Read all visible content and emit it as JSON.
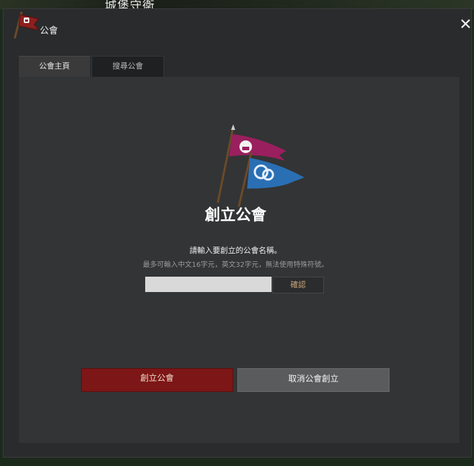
{
  "background": {
    "title": "城堡守衛"
  },
  "window": {
    "title": "公會",
    "close_label": "✕"
  },
  "tabs": [
    {
      "label": "公會主頁",
      "active": true
    },
    {
      "label": "搜尋公會",
      "active": false
    }
  ],
  "create": {
    "title": "創立公會",
    "prompt": "請輸入要創立的公會名稱。",
    "hint": "最多可輸入中文16字元，英文32字元，無法使用特殊符號。",
    "input": {
      "value": "",
      "placeholder": ""
    },
    "confirm_label": "確認"
  },
  "actions": {
    "create_label": "創立公會",
    "cancel_label": "取消公會創立"
  },
  "colors": {
    "create_button": "#7d1616",
    "cancel_button": "#5a5b5c",
    "flag_red": "#9a1f5e",
    "flag_blue": "#2a6fb4"
  }
}
